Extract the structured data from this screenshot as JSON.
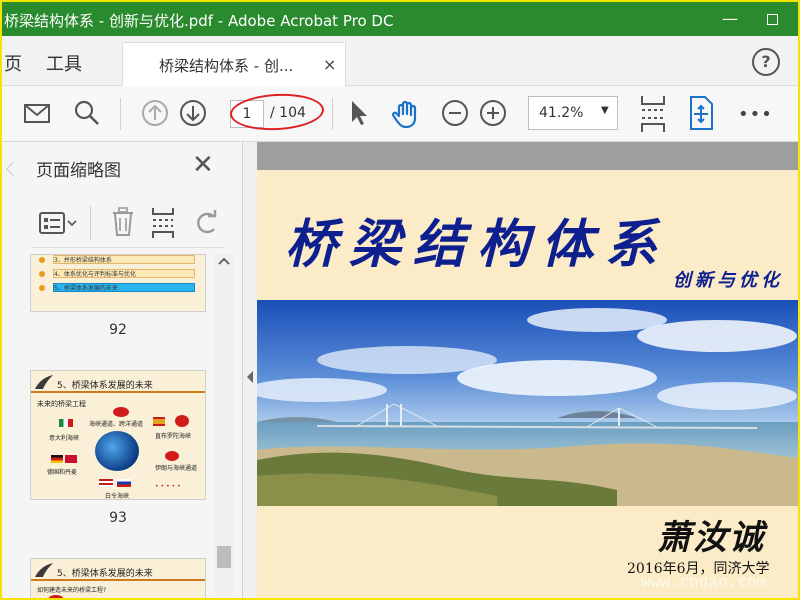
{
  "window": {
    "title": "桥梁结构体系 - 创新与优化.pdf - Adobe Acrobat Pro DC",
    "minimize": "—"
  },
  "tabs": {
    "home": "页",
    "tools": "工具",
    "document": "桥梁结构体系 - 创...",
    "close": "×",
    "help": "?"
  },
  "toolbar": {
    "current_page": "1",
    "total_pages": "/ 104",
    "zoom": "41.2%",
    "zoom_arrow": "▼",
    "more": "•••",
    "accent": "#1a73c9"
  },
  "sidebar": {
    "title": "页面缩略图",
    "close": "✕",
    "thumbnails": [
      {
        "number": "92",
        "items": [
          "3、并形桥梁结构体系",
          "4、体系优化与评判标准与优化",
          "5、桥梁体系发展的未来"
        ]
      },
      {
        "number": "93",
        "heading": "5、桥梁体系发展的未来",
        "sub": "未来的桥梁工程",
        "labels": [
          "海峡通道、跨洋通道",
          "意大利海峡",
          "直布罗陀海峡",
          "德国和丹麦",
          "伊朗与海峡通道",
          "白令海峡"
        ]
      },
      {
        "heading": "5、桥梁体系发展的未来",
        "sub": "如何建造未来的桥梁工程?"
      }
    ]
  },
  "slide": {
    "title": "桥梁结构体系",
    "subtitle": "创新与优化",
    "author": "萧汝诚",
    "date": "2016年6月，同济大学",
    "watermark": "www.cndao.com"
  }
}
